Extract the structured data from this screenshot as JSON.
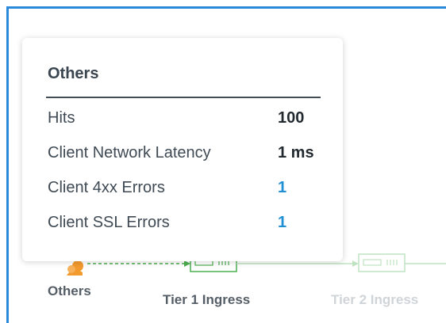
{
  "popover": {
    "title": "Others",
    "metrics": [
      {
        "label": "Hits",
        "value": "100",
        "link": false
      },
      {
        "label": "Client Network Latency",
        "value": "1 ms",
        "link": false
      },
      {
        "label": "Client 4xx Errors",
        "value": "1",
        "link": true
      },
      {
        "label": "Client SSL Errors",
        "value": "1",
        "link": true
      }
    ]
  },
  "topology": {
    "nodes": [
      {
        "label": "Others",
        "icon": "client-users-icon"
      },
      {
        "label": "Tier 1 Ingress",
        "icon": "load-balancer-icon"
      },
      {
        "label": "Tier 2 Ingress",
        "icon": "load-balancer-icon",
        "faded": true
      }
    ]
  },
  "colors": {
    "accent_border": "#2a8ad9",
    "link": "#1f8fd6",
    "connector": "#4caf50"
  }
}
